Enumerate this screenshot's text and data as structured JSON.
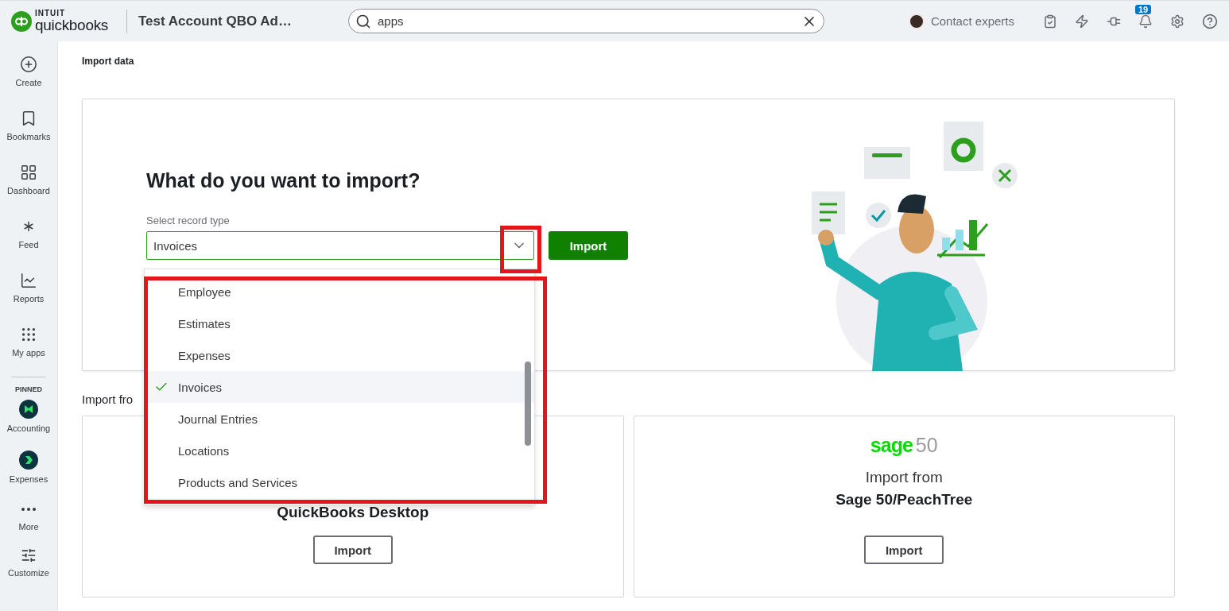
{
  "topbar": {
    "brand_top": "INTUIT",
    "brand_name": "quickbooks",
    "company": "Test Account QBO Ad…",
    "contact": "Contact experts",
    "notifications": "19"
  },
  "search": {
    "value": "apps"
  },
  "sidebar": {
    "items": [
      "Create",
      "Bookmarks",
      "Dashboard",
      "Feed",
      "Reports",
      "My apps"
    ],
    "pinned_heading": "PINNED",
    "pinned": [
      "Accounting",
      "Expenses"
    ],
    "bottom": [
      "More",
      "Customize"
    ]
  },
  "page": {
    "breadcrumb": "Import data"
  },
  "import_card": {
    "heading": "What do you want to import?",
    "label": "Select record type",
    "value": "Invoices",
    "button": "Import",
    "options": [
      {
        "label": "Employee",
        "selected": false
      },
      {
        "label": "Estimates",
        "selected": false
      },
      {
        "label": "Expenses",
        "selected": false
      },
      {
        "label": "Invoices",
        "selected": true
      },
      {
        "label": "Journal Entries",
        "selected": false
      },
      {
        "label": "Locations",
        "selected": false
      },
      {
        "label": "Products and Services",
        "selected": false
      }
    ]
  },
  "import_from": {
    "heading": "Import fro",
    "sources": [
      {
        "kind": "quickbooks",
        "title": "QuickBooks Desktop",
        "button": "Import"
      },
      {
        "kind": "sage",
        "logo_word": "sage",
        "logo_number": "50",
        "subtitle": "Import from",
        "title": "Sage 50/PeachTree",
        "button": "Import"
      }
    ]
  }
}
